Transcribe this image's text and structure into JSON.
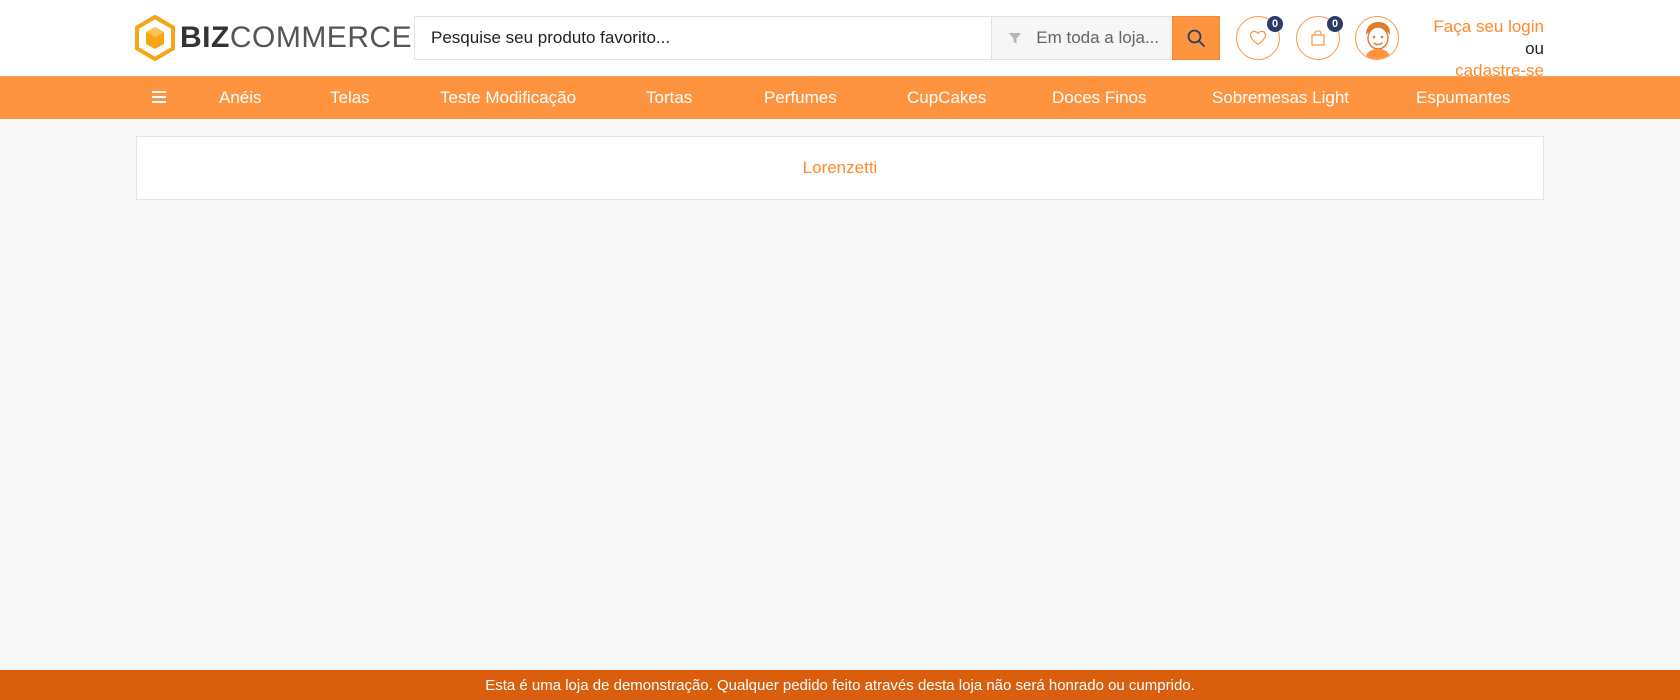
{
  "header": {
    "logo": {
      "part1": "BIZ",
      "part2": "COMMERCE"
    },
    "search": {
      "placeholder": "Pesquise seu produto favorito...",
      "scope": "Em toda a loja...",
      "scope_icon": "filter-icon",
      "button_icon": "search-icon"
    },
    "wishlist": {
      "icon": "heart-icon",
      "count": "0"
    },
    "cart": {
      "icon": "shopping-bag-icon",
      "count": "0"
    },
    "account": {
      "avatar_icon": "user-avatar-icon",
      "login_text": "Faça seu login",
      "or_text": "ou",
      "register_text": "cadastre-se"
    }
  },
  "nav": {
    "menu_icon": "hamburger-menu-icon",
    "items": [
      {
        "label": "Anéis"
      },
      {
        "label": "Telas"
      },
      {
        "label": "Teste Modificação"
      },
      {
        "label": "Tortas"
      },
      {
        "label": "Perfumes"
      },
      {
        "label": "CupCakes"
      },
      {
        "label": "Doces Finos"
      },
      {
        "label": "Sobremesas Light"
      },
      {
        "label": "Espumantes"
      }
    ]
  },
  "main": {
    "brand_name": "Lorenzetti"
  },
  "footer": {
    "demo_notice": "Esta é uma loja de demonstração. Qualquer pedido feito através desta loja não será honrado ou cumprido."
  },
  "colors": {
    "accent": "#ff9440",
    "accent_text": "#ff8a2b",
    "footer_bar": "#d95f0e",
    "badge": "#2b3a66"
  }
}
